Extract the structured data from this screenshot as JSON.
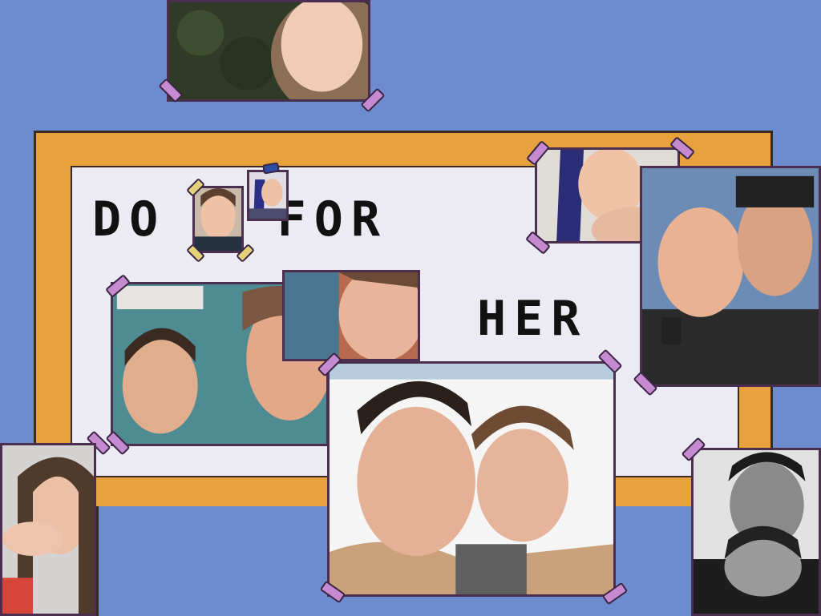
{
  "sign": {
    "line1": "DO T FOR",
    "line2": "HER"
  },
  "photos": [
    {
      "name": "photo-girl-top"
    },
    {
      "name": "photo-girl-blue-hair"
    },
    {
      "name": "photo-couple-hug-watch"
    },
    {
      "name": "photo-couple-window"
    },
    {
      "name": "photo-girl-half-face"
    },
    {
      "name": "photo-couple-selfie-center"
    },
    {
      "name": "photo-girl-hand-left"
    },
    {
      "name": "photo-couple-bw"
    },
    {
      "name": "photo-girl-small-1"
    },
    {
      "name": "photo-girl-small-2"
    }
  ],
  "colors": {
    "background": "#6d8ccf",
    "board": "#e8a23d",
    "sign": "#eceaf2",
    "tape": "#c68ad0"
  }
}
